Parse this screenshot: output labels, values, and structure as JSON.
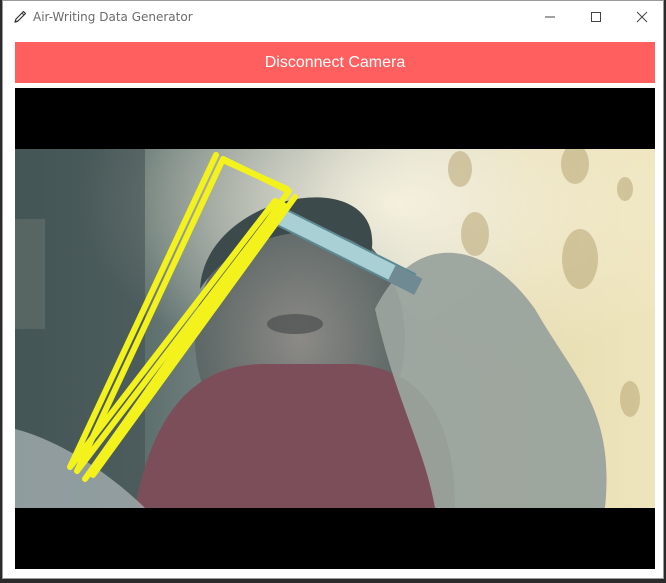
{
  "window": {
    "title": "Air-Writing Data Generator",
    "app_icon": "pencil-icon"
  },
  "controls": {
    "minimize_icon": "minimize-icon",
    "maximize_icon": "maximize-icon",
    "close_icon": "close-icon"
  },
  "toolbar": {
    "camera_button_label": "Disconnect Camera",
    "camera_button_color": "#ff5f5f"
  },
  "camera_feed": {
    "trace_color": "#f4f21c",
    "letterbox_color": "#000000"
  }
}
